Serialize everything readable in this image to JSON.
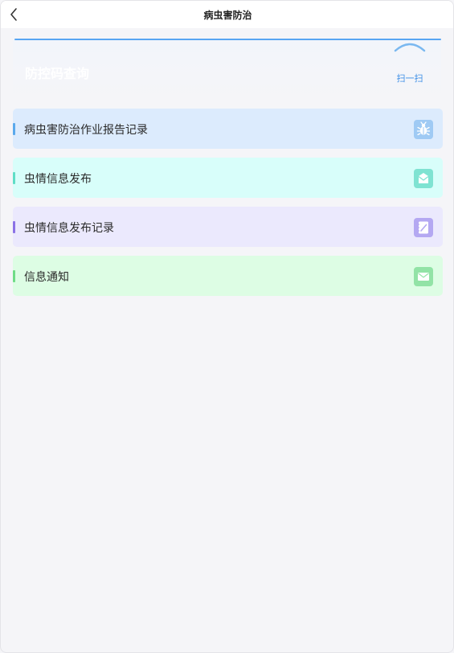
{
  "header": {
    "title": "病虫害防治"
  },
  "banner": {
    "title": "防控码查询",
    "scan_label": "扫一扫"
  },
  "menu": [
    {
      "label": "病虫害防治作业报告记录",
      "icon": "bug-icon",
      "accent": "#5aa9ec",
      "bg": "#dcebfd",
      "icon_bg": "#9fcaf4"
    },
    {
      "label": "虫情信息发布",
      "icon": "envelope-icon",
      "accent": "#5fdec6",
      "bg": "#d8fefa",
      "icon_bg": "#7fe3d2"
    },
    {
      "label": "虫情信息发布记录",
      "icon": "notebook-icon",
      "accent": "#8b72e6",
      "bg": "#ebe9fd",
      "icon_bg": "#b4a8f2"
    },
    {
      "label": "信息通知",
      "icon": "mail-icon",
      "accent": "#6fdc86",
      "bg": "#ddfde4",
      "icon_bg": "#92e3a6"
    }
  ]
}
